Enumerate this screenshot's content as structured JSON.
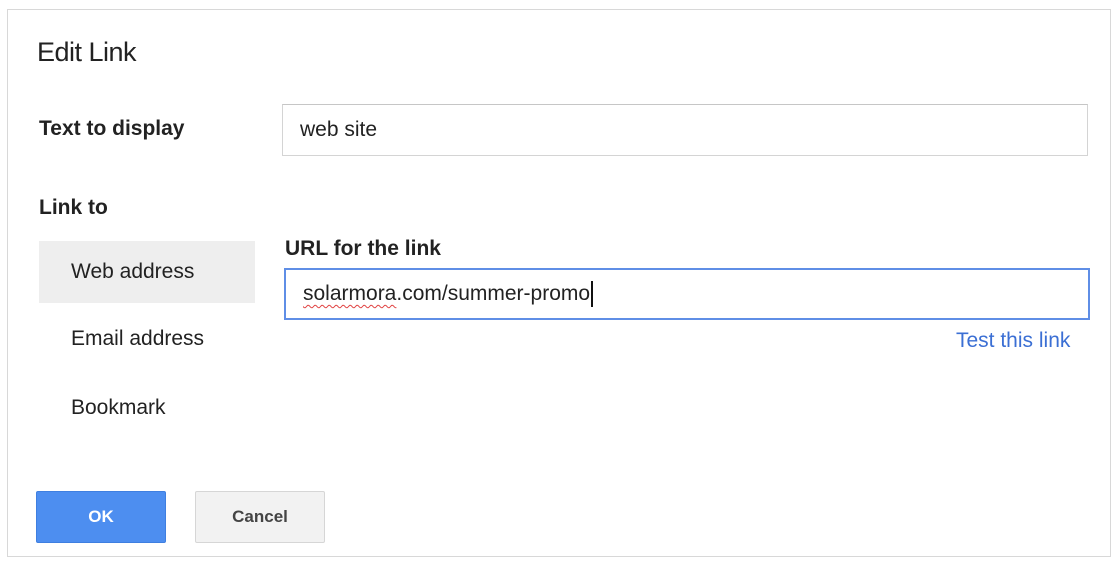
{
  "dialog": {
    "title": "Edit Link",
    "text_to_display": {
      "label": "Text to display",
      "value": "web site"
    },
    "link_to": {
      "label": "Link to",
      "options": [
        {
          "label": "Web address",
          "selected": true
        },
        {
          "label": "Email address",
          "selected": false
        },
        {
          "label": "Bookmark",
          "selected": false
        }
      ]
    },
    "url": {
      "label": "URL for the link",
      "value_misspelled_part": "solarmora",
      "value_rest": ".com/summer-promo",
      "test_link": "Test this link"
    },
    "buttons": {
      "ok": "OK",
      "cancel": "Cancel"
    }
  },
  "colors": {
    "accent_blue": "#4d8ef0",
    "link_blue": "#3b6fd4",
    "focus_border": "#5f8ee6",
    "selected_bg": "#eeeeee",
    "spell_underline": "#e04040"
  }
}
